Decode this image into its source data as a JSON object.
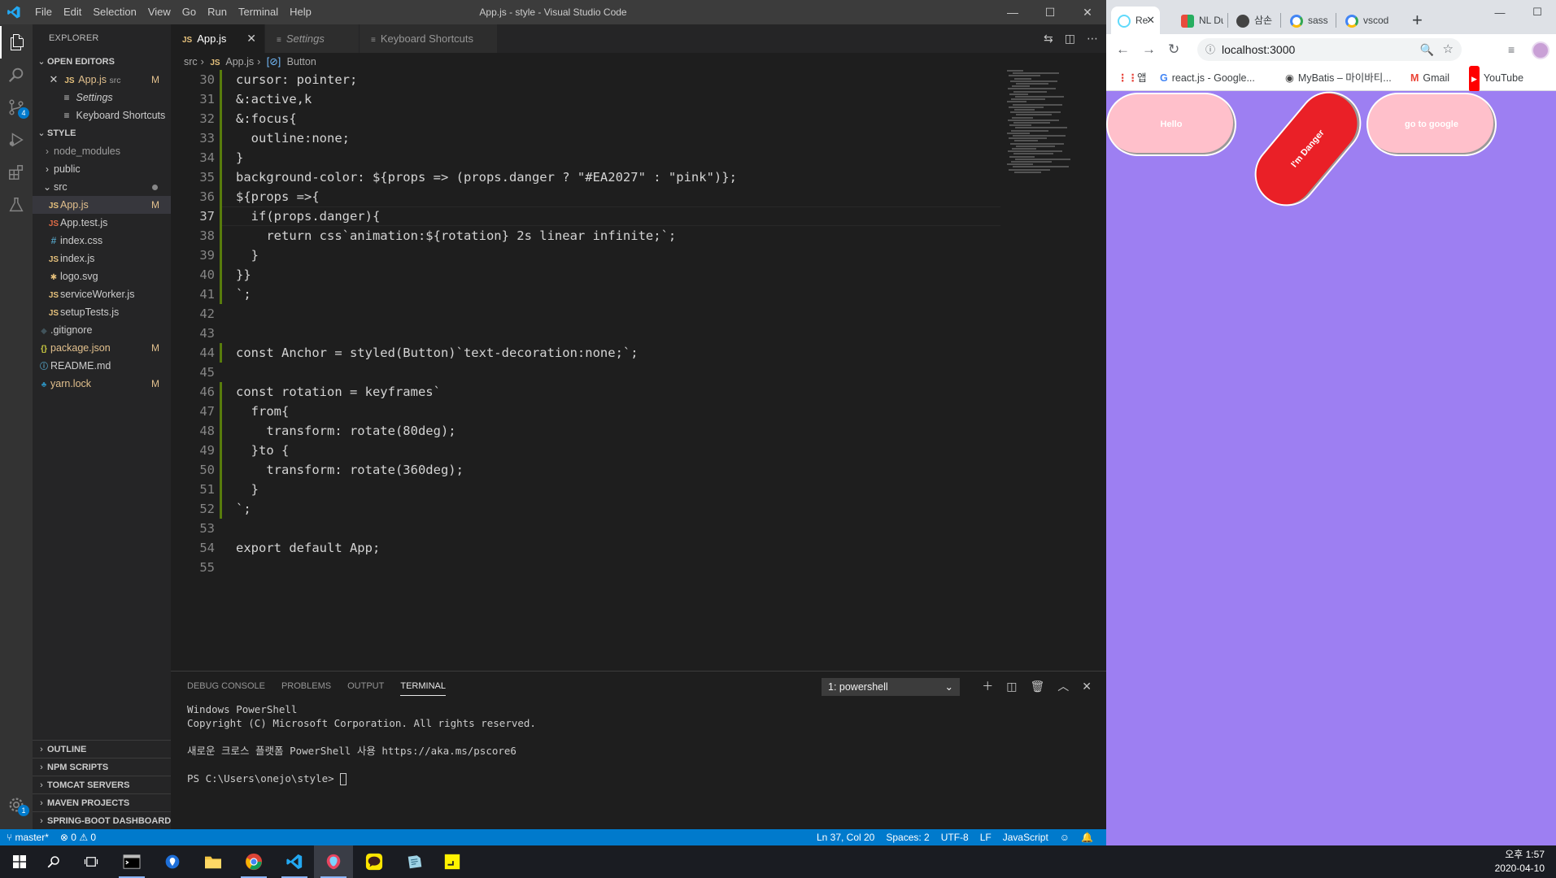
{
  "vscode": {
    "title": "App.js - style - Visual Studio Code",
    "menu": [
      "File",
      "Edit",
      "Selection",
      "View",
      "Go",
      "Run",
      "Terminal",
      "Help"
    ],
    "window_controls": {
      "minimize": "—",
      "maximize": "☐",
      "close": "✕"
    },
    "activity": {
      "scm_badge": "4",
      "settings_badge": "1"
    },
    "explorer": {
      "header": "EXPLORER",
      "open_editors_label": "OPEN EDITORS",
      "open_editors": [
        {
          "name": "App.js",
          "hint": "src",
          "mark": "M",
          "type": "JS"
        },
        {
          "name": "Settings",
          "type": "settings"
        },
        {
          "name": "Keyboard Shortcuts",
          "type": "keyboard"
        }
      ],
      "workspace_label": "STYLE",
      "tree": [
        {
          "name": "node_modules",
          "kind": "folder"
        },
        {
          "name": "public",
          "kind": "folder"
        },
        {
          "name": "src",
          "kind": "folder-open"
        },
        {
          "name": "App.js",
          "kind": "js",
          "mark": "M"
        },
        {
          "name": "App.test.js",
          "kind": "js"
        },
        {
          "name": "index.css",
          "kind": "css"
        },
        {
          "name": "index.js",
          "kind": "js"
        },
        {
          "name": "logo.svg",
          "kind": "svg"
        },
        {
          "name": "serviceWorker.js",
          "kind": "js"
        },
        {
          "name": "setupTests.js",
          "kind": "js"
        },
        {
          "name": ".gitignore",
          "kind": "git"
        },
        {
          "name": "package.json",
          "kind": "json",
          "mark": "M"
        },
        {
          "name": "README.md",
          "kind": "info"
        },
        {
          "name": "yarn.lock",
          "kind": "yarn",
          "mark": "M"
        }
      ],
      "bottom_sections": [
        "OUTLINE",
        "NPM SCRIPTS",
        "TOMCAT SERVERS",
        "MAVEN PROJECTS",
        "SPRING-BOOT DASHBOARD"
      ]
    },
    "tabs": [
      {
        "label": "App.js",
        "icon": "JS",
        "active": true
      },
      {
        "label": "Settings",
        "icon": "≡",
        "active": false
      },
      {
        "label": "Keyboard Shortcuts",
        "icon": "≡",
        "active": false
      }
    ],
    "breadcrumb": {
      "folder": "src",
      "file": "App.js",
      "symbol": "Button"
    },
    "code_lines": [
      {
        "n": "30",
        "text": "cursor: pointer;"
      },
      {
        "n": "31",
        "text": "&:active,k"
      },
      {
        "n": "32",
        "text": "&:focus{"
      },
      {
        "n": "33",
        "text": "  outline:none;"
      },
      {
        "n": "34",
        "text": "}"
      },
      {
        "n": "35",
        "text": "background-color: ${props => (props.danger ? \"#EA2027\" : \"pink\")};"
      },
      {
        "n": "36",
        "text": "${props =>{"
      },
      {
        "n": "37",
        "text": "  if(props.danger){"
      },
      {
        "n": "38",
        "text": "    return css`animation:${rotation} 2s linear infinite;`;"
      },
      {
        "n": "39",
        "text": "  }"
      },
      {
        "n": "40",
        "text": "}}"
      },
      {
        "n": "41",
        "text": "`;"
      },
      {
        "n": "42",
        "text": ""
      },
      {
        "n": "43",
        "text": ""
      },
      {
        "n": "44",
        "text": "const Anchor = styled(Button)`text-decoration:none;`;"
      },
      {
        "n": "45",
        "text": ""
      },
      {
        "n": "46",
        "text": "const rotation = keyframes`"
      },
      {
        "n": "47",
        "text": "  from{"
      },
      {
        "n": "48",
        "text": "    transform: rotate(80deg);"
      },
      {
        "n": "49",
        "text": "  }to {"
      },
      {
        "n": "50",
        "text": "    transform: rotate(360deg);"
      },
      {
        "n": "51",
        "text": "  }"
      },
      {
        "n": "52",
        "text": "`;"
      },
      {
        "n": "53",
        "text": ""
      },
      {
        "n": "54",
        "text": "export default App;"
      },
      {
        "n": "55",
        "text": ""
      }
    ],
    "panel": {
      "tabs": [
        "DEBUG CONSOLE",
        "PROBLEMS",
        "OUTPUT",
        "TERMINAL"
      ],
      "active_tab": "TERMINAL",
      "terminal_select": "1: powershell",
      "terminal_lines": [
        "Windows PowerShell",
        "Copyright (C) Microsoft Corporation. All rights reserved.",
        "",
        "새로운 크로스 플랫폼 PowerShell 사용 https://aka.ms/pscore6",
        "",
        "PS C:\\Users\\onejo\\style> "
      ]
    },
    "status": {
      "branch": "master*",
      "errors": "0",
      "warnings": "0",
      "position": "Ln 37, Col 20",
      "spaces": "Spaces: 2",
      "encoding": "UTF-8",
      "eol": "LF",
      "language": "JavaScript"
    }
  },
  "chrome": {
    "tabs": [
      {
        "label": "Re",
        "favicon_color": "#61dafb",
        "active": true
      },
      {
        "label": "NL Du",
        "favicon_color": "#e94c3c"
      },
      {
        "label": "삼손",
        "favicon_color": "#444444"
      },
      {
        "label": "sass",
        "favicon_color": "#4285f4"
      },
      {
        "label": "vscod",
        "favicon_color": "#4285f4"
      }
    ],
    "url": "localhost:3000",
    "bookmarks": [
      {
        "label": "",
        "icon": "apps"
      },
      {
        "label": "앱",
        "icon": "none"
      },
      {
        "label": "react.js - Google...",
        "icon": "G"
      },
      {
        "label": "MyBatis – 마이바티...",
        "icon": "mybatis"
      },
      {
        "label": "Gmail",
        "icon": "M"
      },
      {
        "label": "YouTube",
        "icon": "youtube"
      }
    ],
    "page": {
      "background": "#9d7ff2",
      "buttons": [
        {
          "label": "Hello",
          "color": "#ffc0cb"
        },
        {
          "label": "I'm Danger",
          "color": "#ea2027",
          "rotation_deg": -50
        },
        {
          "label": "go to google",
          "color": "#ffc0cb"
        }
      ]
    }
  },
  "taskbar": {
    "time": "오후 1:57",
    "date": "2020-04-10"
  }
}
